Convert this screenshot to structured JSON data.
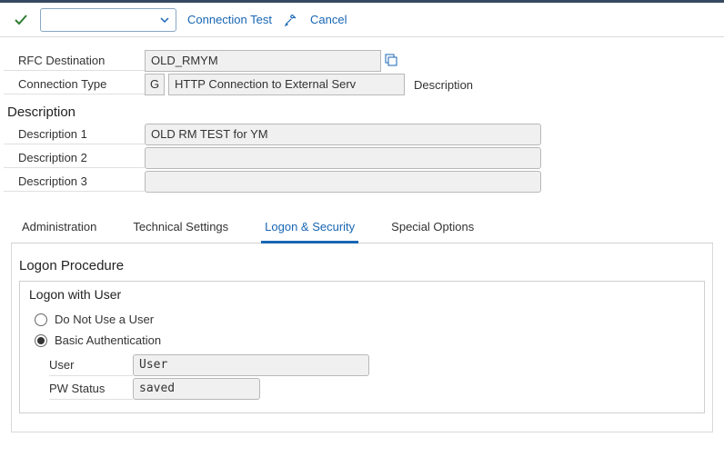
{
  "toolbar": {
    "connection_test": "Connection Test",
    "cancel": "Cancel"
  },
  "header": {
    "rfc_destination_label": "RFC Destination",
    "rfc_destination_value": "OLD_RMYM",
    "connection_type_label": "Connection Type",
    "connection_type_code": "G",
    "connection_type_value": "HTTP Connection to External Serv",
    "description_side_label": "Description"
  },
  "description": {
    "section_title": "Description",
    "desc1_label": "Description 1",
    "desc1_value": "OLD RM TEST for YM",
    "desc2_label": "Description 2",
    "desc2_value": "",
    "desc3_label": "Description 3",
    "desc3_value": ""
  },
  "tabs": {
    "administration": "Administration",
    "technical_settings": "Technical Settings",
    "logon_security": "Logon & Security",
    "special_options": "Special Options"
  },
  "logon": {
    "procedure_title": "Logon Procedure",
    "group_title": "Logon with User",
    "radio_no_user": "Do Not Use a User",
    "radio_basic_auth": "Basic Authentication",
    "user_label": "User",
    "user_value": "User",
    "pw_status_label": "PW Status",
    "pw_status_value": "saved"
  }
}
